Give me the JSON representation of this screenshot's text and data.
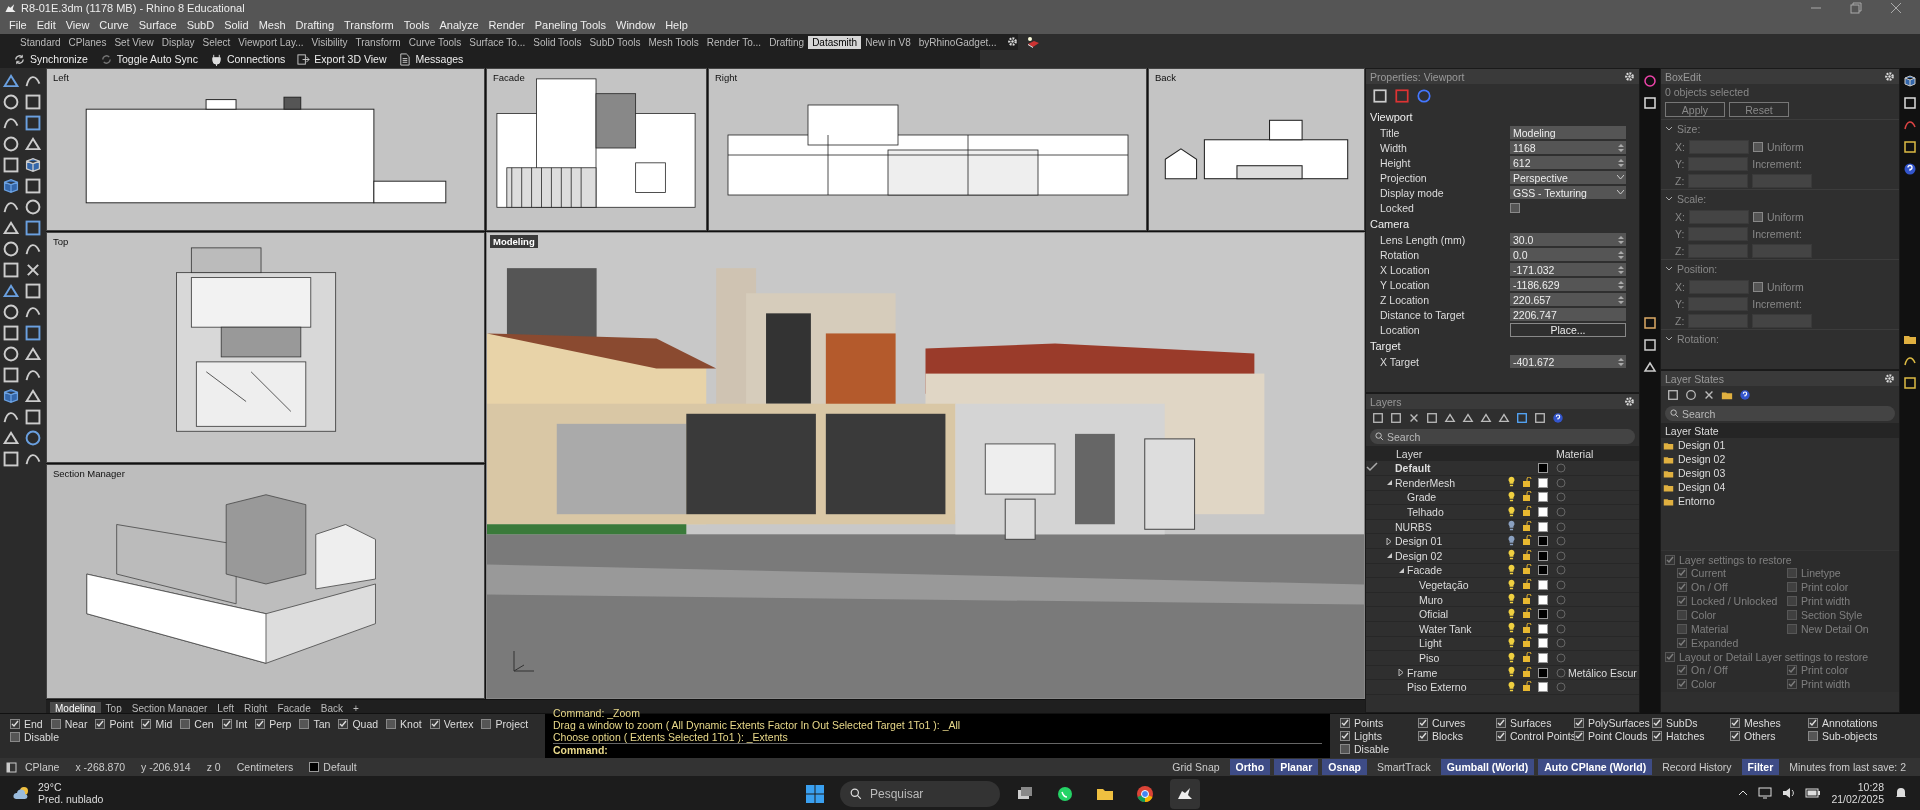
{
  "window": {
    "title": "R8-01E.3dm (1178 MB) - Rhino 8 Educational"
  },
  "menu": [
    "File",
    "Edit",
    "View",
    "Curve",
    "Surface",
    "SubD",
    "Solid",
    "Mesh",
    "Drafting",
    "Transform",
    "Tools",
    "Analyze",
    "Render",
    "Paneling Tools",
    "Window",
    "Help"
  ],
  "toolbar_tabs": [
    {
      "label": "Standard",
      "selected": false
    },
    {
      "label": "CPlanes",
      "selected": false
    },
    {
      "label": "Set View",
      "selected": false
    },
    {
      "label": "Display",
      "selected": false
    },
    {
      "label": "Select",
      "selected": false
    },
    {
      "label": "Viewport Lay...",
      "selected": false
    },
    {
      "label": "Visibility",
      "selected": false
    },
    {
      "label": "Transform",
      "selected": false
    },
    {
      "label": "Curve Tools",
      "selected": false
    },
    {
      "label": "Surface To...",
      "selected": false
    },
    {
      "label": "Solid Tools",
      "selected": false
    },
    {
      "label": "SubD Tools",
      "selected": false
    },
    {
      "label": "Mesh Tools",
      "selected": false
    },
    {
      "label": "Render To...",
      "selected": false
    },
    {
      "label": "Drafting",
      "selected": false
    },
    {
      "label": "Datasmith",
      "selected": true
    },
    {
      "label": "New in V8",
      "selected": false
    },
    {
      "label": "byRhinoGadget...",
      "selected": false
    }
  ],
  "datasmith_toolbar": [
    {
      "label": "Synchronize",
      "kind": "sync"
    },
    {
      "label": "Toggle Auto Sync",
      "kind": "autosync"
    },
    {
      "label": "Connections",
      "kind": "plug"
    },
    {
      "label": "Export 3D View",
      "kind": "export"
    },
    {
      "label": "Messages",
      "kind": "doc"
    }
  ],
  "viewports": [
    {
      "label": "Left",
      "kind": "elevation",
      "active": false
    },
    {
      "label": "Facade",
      "kind": "facade",
      "active": false
    },
    {
      "label": "Right",
      "kind": "elevation-long",
      "active": false
    },
    {
      "label": "Back",
      "kind": "elevation-small",
      "active": false
    },
    {
      "label": "Top",
      "kind": "plan",
      "active": false
    },
    {
      "label": "Section Manager",
      "kind": "model",
      "active": false
    },
    {
      "label": "Modeling",
      "kind": "render",
      "active": true
    }
  ],
  "viewport_tabs": [
    {
      "label": "Modeling",
      "selected": true
    },
    {
      "label": "Top",
      "selected": false
    },
    {
      "label": "Section Manager",
      "selected": false
    },
    {
      "label": "Left",
      "selected": false
    },
    {
      "label": "Right",
      "selected": false
    },
    {
      "label": "Facade",
      "selected": false
    },
    {
      "label": "Back",
      "selected": false
    },
    {
      "label": "+",
      "selected": false
    }
  ],
  "properties": {
    "title": "Properties: Viewport",
    "sections": [
      {
        "title": "Viewport",
        "rows": [
          {
            "label": "Title",
            "value": "Modeling",
            "kind": "text"
          },
          {
            "label": "Width",
            "value": "1168",
            "kind": "spin"
          },
          {
            "label": "Height",
            "value": "612",
            "kind": "spin"
          },
          {
            "label": "Projection",
            "value": "Perspective",
            "kind": "dropdown"
          },
          {
            "label": "Display mode",
            "value": "GSS - Texturing",
            "kind": "dropdown"
          },
          {
            "label": "Locked",
            "checked": false,
            "kind": "checkbox"
          }
        ]
      },
      {
        "title": "Camera",
        "rows": [
          {
            "label": "Lens Length (mm)",
            "value": "30.0",
            "kind": "spin"
          },
          {
            "label": "Rotation",
            "value": "0.0",
            "kind": "spin"
          },
          {
            "label": "X Location",
            "value": "-171.032",
            "kind": "spin"
          },
          {
            "label": "Y Location",
            "value": "-1186.629",
            "kind": "spin"
          },
          {
            "label": "Z Location",
            "value": "220.657",
            "kind": "spin"
          },
          {
            "label": "Distance to Target",
            "value": "2206.747",
            "kind": "text"
          },
          {
            "label": "Location",
            "value": "Place...",
            "kind": "button"
          }
        ]
      },
      {
        "title": "Target",
        "rows": [
          {
            "label": "X Target",
            "value": "-401.672",
            "kind": "spin"
          }
        ]
      }
    ]
  },
  "boxedit": {
    "title": "BoxEdit",
    "status": "0 objects selected",
    "buttons": [
      "Apply",
      "Reset"
    ],
    "sections": [
      {
        "title": "Size:",
        "expanded": true,
        "axes": [
          "X:",
          "Y:",
          "Z:"
        ],
        "uniform": "Uniform",
        "uniform_checked": false,
        "increment": "Increment:"
      },
      {
        "title": "Scale:",
        "expanded": true,
        "axes": [
          "X:",
          "Y:",
          "Z:"
        ],
        "uniform": "Uniform",
        "uniform_checked": false,
        "increment": "Increment:"
      },
      {
        "title": "Position:",
        "expanded": true,
        "axes": [
          "X:",
          "Y:",
          "Z:"
        ],
        "uniform": "Uniform",
        "uniform_checked": false,
        "increment": "Increment:"
      },
      {
        "title": "Rotation:",
        "expanded": true
      }
    ]
  },
  "layers": {
    "title": "Layers",
    "search": {
      "placeholder": "Search"
    },
    "columns": [
      "Layer",
      "Material"
    ],
    "rows": [
      {
        "name": "Default",
        "current": true,
        "color": "#000000"
      },
      {
        "name": "RenderMesh",
        "current": false,
        "on": true,
        "color": "#ffffff",
        "expanded": true,
        "children": [
          {
            "name": "Grade",
            "current": false,
            "on": true,
            "color": "#ffffff"
          },
          {
            "name": "Telhado",
            "current": false,
            "on": true,
            "color": "#ffffff"
          }
        ]
      },
      {
        "name": "NURBS",
        "current": false,
        "on": false,
        "color": "#ffffff"
      },
      {
        "name": "Design 01",
        "current": false,
        "on": false,
        "color": "#000000",
        "expanded": false
      },
      {
        "name": "Design 02",
        "current": false,
        "on": true,
        "color": "#000000",
        "expanded": true,
        "children": [
          {
            "name": "Facade",
            "current": false,
            "on": true,
            "color": "#000000",
            "expanded": true,
            "children": [
              {
                "name": "Vegetação",
                "current": false,
                "on": true,
                "color": "#ffffff"
              },
              {
                "name": "Muro",
                "current": false,
                "on": true,
                "color": "#ffffff"
              },
              {
                "name": "Oficial",
                "current": false,
                "on": true,
                "color": "#000000"
              },
              {
                "name": "Water Tank",
                "current": false,
                "on": true,
                "color": "#ffffff"
              },
              {
                "name": "Light",
                "current": false,
                "on": true,
                "color": "#ffffff"
              },
              {
                "name": "Piso",
                "current": false,
                "on": true,
                "color": "#ffffff"
              }
            ]
          },
          {
            "name": "Frame",
            "current": false,
            "on": true,
            "color": "#000000",
            "expanded": false,
            "material": "Metálico Escur"
          },
          {
            "name": "Piso Externo",
            "current": false,
            "on": true,
            "color": "#ffffff"
          }
        ]
      }
    ]
  },
  "layer_states": {
    "title": "Layer States",
    "search": {
      "placeholder": "Search"
    },
    "column": "Layer State",
    "items": [
      "Design 01",
      "Design 02",
      "Design 03",
      "Design 04",
      "Entorno"
    ],
    "restore": {
      "disabled": true,
      "groups": [
        {
          "label": "Layer settings to restore",
          "checked": true,
          "options": [
            {
              "label": "Current",
              "checked": true
            },
            {
              "label": "Linetype",
              "checked": false
            },
            {
              "label": "On / Off",
              "checked": true
            },
            {
              "label": "Print color",
              "checked": false
            },
            {
              "label": "Locked / Unlocked",
              "checked": true
            },
            {
              "label": "Print width",
              "checked": false
            },
            {
              "label": "Color",
              "checked": false
            },
            {
              "label": "Section Style",
              "checked": false
            },
            {
              "label": "Material",
              "checked": false
            },
            {
              "label": "New Detail On",
              "checked": false
            },
            {
              "label": "Expanded",
              "checked": true
            }
          ]
        },
        {
          "label": "Layout or Detail Layer settings to restore",
          "checked": true,
          "options": [
            {
              "label": "On / Off",
              "checked": true
            },
            {
              "label": "Print color",
              "checked": true
            },
            {
              "label": "Color",
              "checked": true
            },
            {
              "label": "Print width",
              "checked": true
            }
          ]
        }
      ]
    }
  },
  "osnap": [
    {
      "label": "End",
      "checked": true
    },
    {
      "label": "Near",
      "checked": false
    },
    {
      "label": "Point",
      "checked": true
    },
    {
      "label": "Mid",
      "checked": true
    },
    {
      "label": "Cen",
      "checked": false
    },
    {
      "label": "Int",
      "checked": true
    },
    {
      "label": "Perp",
      "checked": true
    },
    {
      "label": "Tan",
      "checked": false
    },
    {
      "label": "Quad",
      "checked": true
    },
    {
      "label": "Knot",
      "checked": false
    },
    {
      "label": "Vertex",
      "checked": true
    },
    {
      "label": "Project",
      "checked": false
    },
    {
      "label": "Disable",
      "checked": false
    }
  ],
  "command_history": [
    "Command: _Zoom",
    "Drag a window to zoom ( All  Dynamic  Extents  Factor  In  Out  Selected  Target  1To1 ): _All",
    "Choose option ( Extents  Selected  1To1 ): _Extents"
  ],
  "command_prompt": "Command:",
  "selection_filter": [
    {
      "label": "Points",
      "checked": true
    },
    {
      "label": "Curves",
      "checked": true
    },
    {
      "label": "Surfaces",
      "checked": true
    },
    {
      "label": "PolySurfaces",
      "checked": true
    },
    {
      "label": "SubDs",
      "checked": true
    },
    {
      "label": "Meshes",
      "checked": true
    },
    {
      "label": "Annotations",
      "checked": true
    },
    {
      "label": "Lights",
      "checked": true
    },
    {
      "label": "Blocks",
      "checked": true
    },
    {
      "label": "Control Points",
      "checked": true
    },
    {
      "label": "Point Clouds",
      "checked": true
    },
    {
      "label": "Hatches",
      "checked": true
    },
    {
      "label": "Others",
      "checked": true
    },
    {
      "label": "Sub-objects",
      "checked": false
    },
    {
      "label": "Disable",
      "checked": false
    }
  ],
  "status_bar": [
    {
      "kind": "text",
      "label": "CPlane"
    },
    {
      "kind": "text",
      "label": "x -268.870"
    },
    {
      "kind": "text",
      "label": "y -206.914"
    },
    {
      "kind": "text",
      "label": "z 0"
    },
    {
      "kind": "text",
      "label": "Centimeters"
    },
    {
      "kind": "layer",
      "label": "Default"
    },
    {
      "kind": "spacer"
    },
    {
      "kind": "text",
      "label": "Grid Snap"
    },
    {
      "kind": "toggle",
      "label": "Ortho",
      "on": true
    },
    {
      "kind": "toggle",
      "label": "Planar",
      "on": true
    },
    {
      "kind": "toggle",
      "label": "Osnap",
      "on": true
    },
    {
      "kind": "toggle",
      "label": "SmartTrack",
      "on": false
    },
    {
      "kind": "toggle",
      "label": "Gumball (World)",
      "on": true
    },
    {
      "kind": "toggle",
      "label": "Auto CPlane (World)",
      "on": true
    },
    {
      "kind": "toggle",
      "label": "Record History",
      "on": false
    },
    {
      "kind": "toggle",
      "label": "Filter",
      "on": true
    },
    {
      "kind": "text",
      "label": "Minutes from last save: 2"
    }
  ],
  "taskbar": {
    "weather": {
      "temperature": "29°C",
      "condition": "Pred. nublado"
    },
    "search": {
      "placeholder": "Pesquisar"
    },
    "apps": [
      {
        "kind": "taskview",
        "active": false
      },
      {
        "kind": "whatsapp",
        "active": false
      },
      {
        "kind": "folder",
        "active": false
      },
      {
        "kind": "chrome",
        "active": false
      },
      {
        "kind": "rhino",
        "active": true
      }
    ],
    "time": "10:28",
    "date": "21/02/2025"
  }
}
